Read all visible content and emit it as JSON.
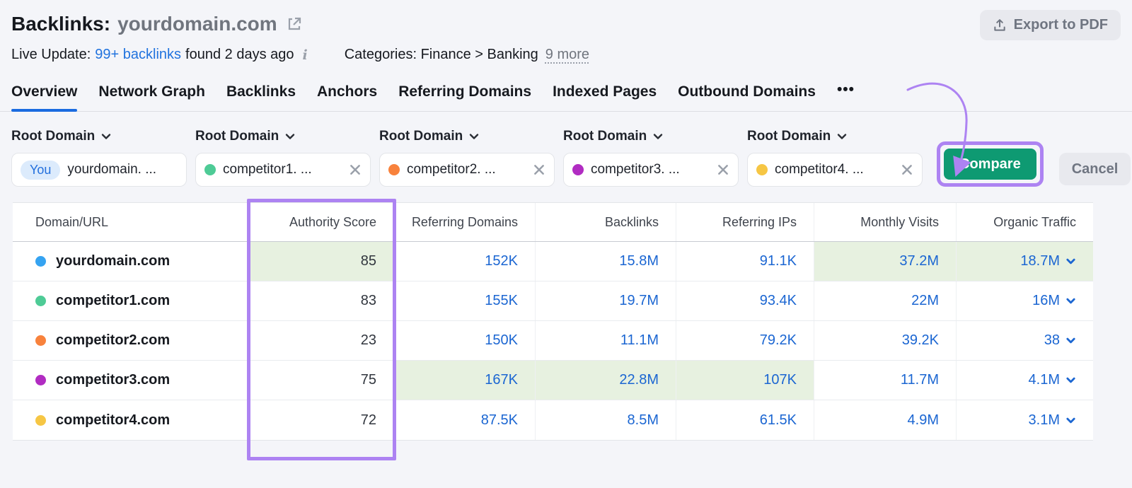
{
  "header": {
    "title_prefix": "Backlinks:",
    "title_domain": "yourdomain.com",
    "export_label": "Export to PDF",
    "live_update_prefix": "Live Update:",
    "live_update_link": "99+ backlinks",
    "live_update_suffix": "found 2 days ago",
    "categories_label": "Categories: Finance > Banking",
    "categories_more": "9 more"
  },
  "tabs": {
    "items": [
      "Overview",
      "Network Graph",
      "Backlinks",
      "Anchors",
      "Referring Domains",
      "Indexed Pages",
      "Outbound Domains"
    ],
    "active": "Overview",
    "overflow": "•••"
  },
  "filters": {
    "dropdown_label": "Root Domain",
    "chips": [
      {
        "badge": "You",
        "label": "yourdomain. ...",
        "dot": null,
        "closable": false
      },
      {
        "badge": null,
        "label": "competitor1. ...",
        "dot": "#4ecb96",
        "closable": true
      },
      {
        "badge": null,
        "label": "competitor2. ...",
        "dot": "#f8823c",
        "closable": true
      },
      {
        "badge": null,
        "label": "competitor3. ...",
        "dot": "#b12cc2",
        "closable": true
      },
      {
        "badge": null,
        "label": "competitor4. ...",
        "dot": "#f6c644",
        "closable": true
      }
    ],
    "compare_label": "Compare",
    "cancel_label": "Cancel"
  },
  "table": {
    "columns": [
      {
        "key": "domain",
        "label": "Domain/URL"
      },
      {
        "key": "authority_score",
        "label": "Authority Score"
      },
      {
        "key": "referring_domains",
        "label": "Referring Domains"
      },
      {
        "key": "backlinks",
        "label": "Backlinks"
      },
      {
        "key": "referring_ips",
        "label": "Referring IPs"
      },
      {
        "key": "monthly_visits",
        "label": "Monthly Visits"
      },
      {
        "key": "organic_traffic",
        "label": "Organic Traffic"
      }
    ],
    "rows": [
      {
        "domain": "yourdomain.com",
        "dot": "#35a3f1",
        "authority_score": "85",
        "referring_domains": "152K",
        "backlinks": "15.8M",
        "referring_ips": "91.1K",
        "monthly_visits": "37.2M",
        "organic_traffic": "18.7M",
        "highlighted": [
          "authority_score",
          "monthly_visits",
          "organic_traffic"
        ]
      },
      {
        "domain": "competitor1.com",
        "dot": "#4ecb96",
        "authority_score": "83",
        "referring_domains": "155K",
        "backlinks": "19.7M",
        "referring_ips": "93.4K",
        "monthly_visits": "22M",
        "organic_traffic": "16M",
        "highlighted": []
      },
      {
        "domain": "competitor2.com",
        "dot": "#f8823c",
        "authority_score": "23",
        "referring_domains": "150K",
        "backlinks": "11.1M",
        "referring_ips": "79.2K",
        "monthly_visits": "39.2K",
        "organic_traffic": "38",
        "highlighted": []
      },
      {
        "domain": "competitor3.com",
        "dot": "#b12cc2",
        "authority_score": "75",
        "referring_domains": "167K",
        "backlinks": "22.8M",
        "referring_ips": "107K",
        "monthly_visits": "11.7M",
        "organic_traffic": "4.1M",
        "highlighted": [
          "referring_domains",
          "backlinks",
          "referring_ips"
        ]
      },
      {
        "domain": "competitor4.com",
        "dot": "#f6c644",
        "authority_score": "72",
        "referring_domains": "87.5K",
        "backlinks": "8.5M",
        "referring_ips": "61.5K",
        "monthly_visits": "4.9M",
        "organic_traffic": "3.1M",
        "highlighted": []
      }
    ]
  },
  "colors": {
    "annotation_purple": "#ad83f2",
    "compare_green": "#0e9a72",
    "link_blue": "#1b66d2",
    "highlight_green": "#e7f1e0",
    "tab_active_blue": "#1a6be0"
  }
}
